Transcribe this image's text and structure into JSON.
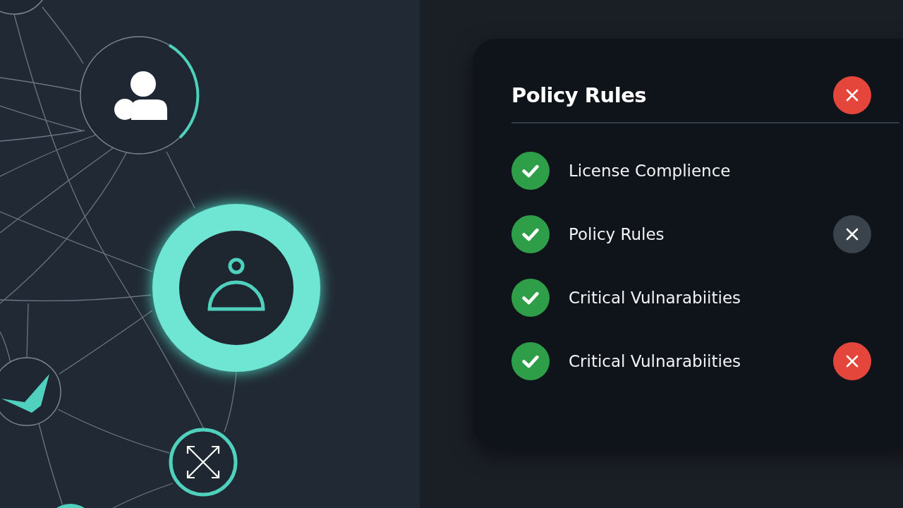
{
  "panel": {
    "title": "Policy Rules",
    "close_button": {
      "color": "#e5463c"
    }
  },
  "rules": [
    {
      "name": "License Complience",
      "passed": true
    },
    {
      "name": "Policy Rules",
      "passed": true,
      "color": "#3a424b"
    },
    {
      "name": "Critical Vulnarabiities",
      "passed": true
    },
    {
      "name": "Critical Vulnarabiities",
      "passed": true,
      "color": "#e5463c"
    }
  ]
}
